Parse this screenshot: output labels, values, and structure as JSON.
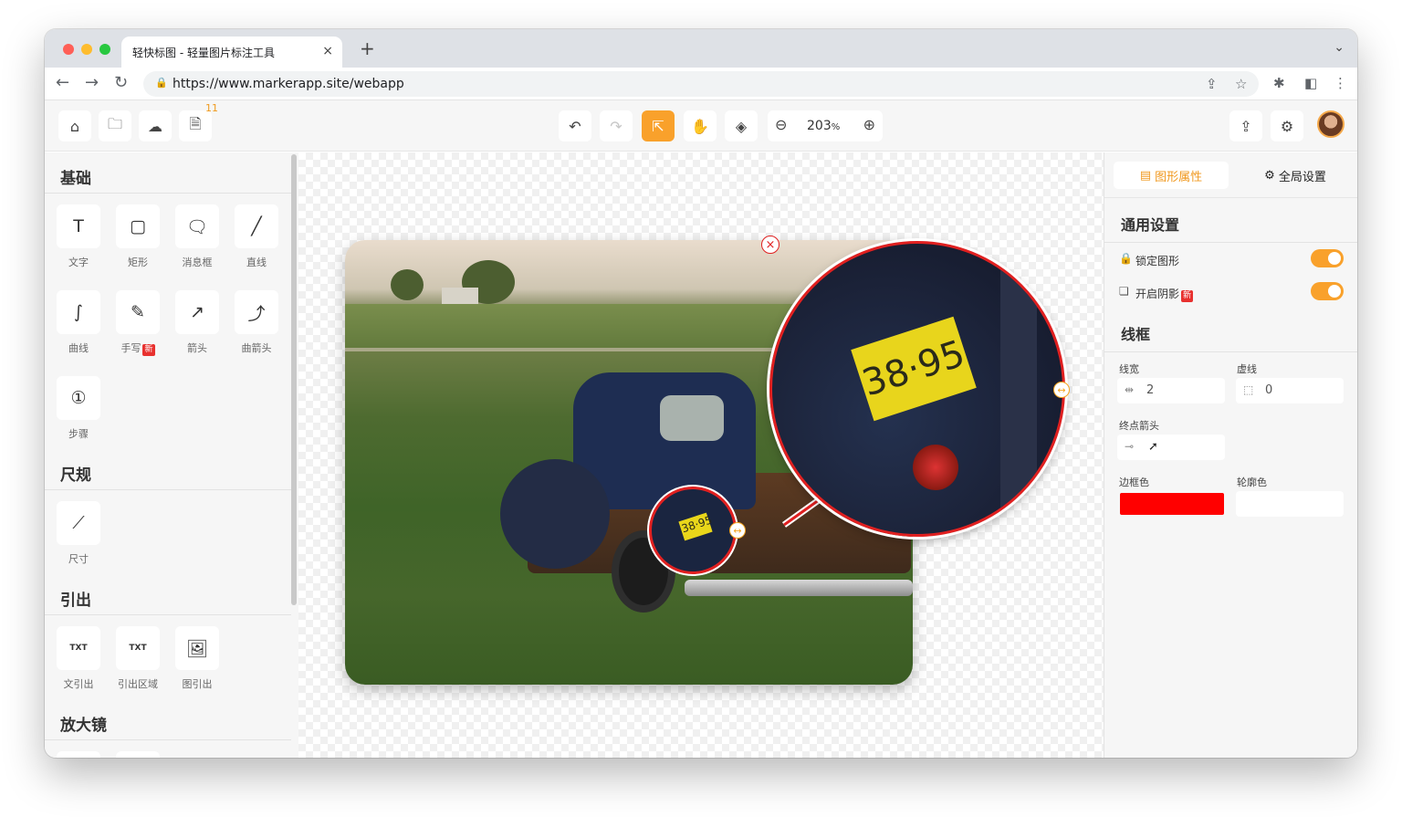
{
  "browser": {
    "tab_title": "轻快标图 - 轻量图片标注工具",
    "tab_close": "×",
    "new_tab": "+",
    "url": "https://www.markerapp.site/webapp"
  },
  "toolbar": {
    "badge_count": "11",
    "zoom_value": "203",
    "zoom_unit": "%"
  },
  "left_panel": {
    "sections": [
      {
        "title": "基础",
        "tools": [
          {
            "label": "文字",
            "icon": "T"
          },
          {
            "label": "矩形",
            "icon": "▢"
          },
          {
            "label": "消息框",
            "icon": "🗨"
          },
          {
            "label": "直线",
            "icon": "╱"
          },
          {
            "label": "曲线",
            "icon": "∫"
          },
          {
            "label": "手写",
            "icon": "✎",
            "badge": "新"
          },
          {
            "label": "箭头",
            "icon": "↗"
          },
          {
            "label": "曲箭头",
            "icon": "⤴"
          },
          {
            "label": "步骤",
            "icon": "①"
          }
        ]
      },
      {
        "title": "尺规",
        "tools": [
          {
            "label": "尺寸",
            "icon": "⟋"
          }
        ]
      },
      {
        "title": "引出",
        "tools": [
          {
            "label": "文引出",
            "icon": "TXT"
          },
          {
            "label": "引出区域",
            "icon": "TXT"
          },
          {
            "label": "图引出",
            "icon": "🖼"
          }
        ]
      },
      {
        "title": "放大镜",
        "tools": []
      }
    ]
  },
  "canvas": {
    "plate_text": "38·95",
    "plate_text_small": "38·95",
    "close_glyph": "×",
    "handle_glyph": "↔"
  },
  "right_panel": {
    "tabs": [
      {
        "label": "图形属性",
        "icon": "▤"
      },
      {
        "label": "全局设置",
        "icon": "⚙"
      }
    ],
    "general_title": "通用设置",
    "lock_label": "锁定图形",
    "shadow_label": "开启阴影",
    "shadow_badge": "新",
    "stroke_title": "线框",
    "line_width_label": "线宽",
    "line_width_value": "2",
    "dash_label": "虚线",
    "dash_value": "0",
    "end_arrow_label": "终点箭头",
    "border_color_label": "边框色",
    "outline_color_label": "轮廓色",
    "border_color": "#ff0000",
    "outline_color": "#ffffff"
  },
  "colors": {
    "accent": "#f9a12b",
    "annotation_red": "#e02020"
  }
}
